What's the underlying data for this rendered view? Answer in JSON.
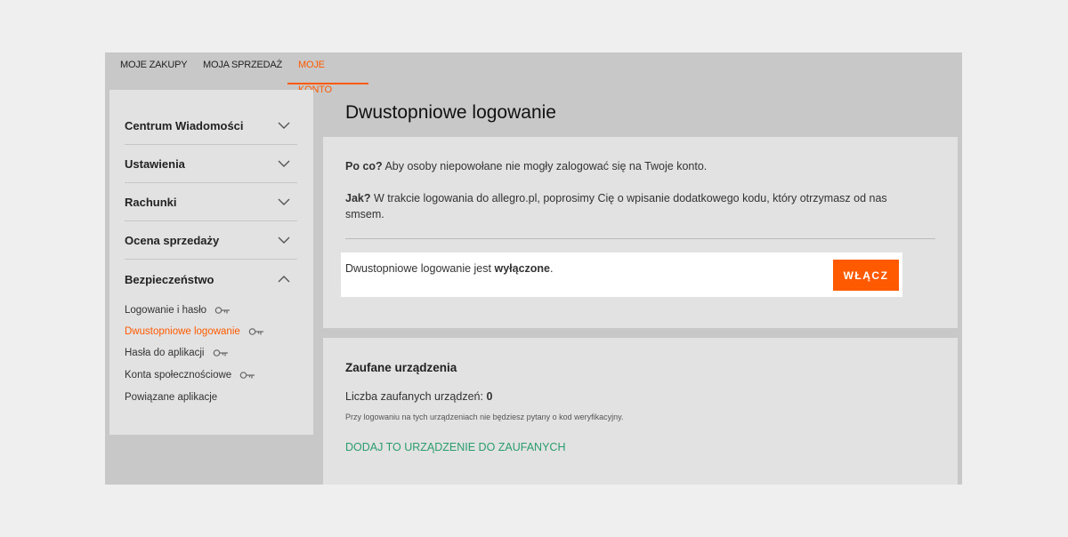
{
  "topnav": {
    "tabs": [
      {
        "label": "MOJE ZAKUPY"
      },
      {
        "label": "MOJA SPRZEDAŻ"
      },
      {
        "label": "MOJE KONTO"
      }
    ]
  },
  "sidebar": {
    "sections": [
      {
        "label": "Centrum Wiadomości"
      },
      {
        "label": "Ustawienia"
      },
      {
        "label": "Rachunki"
      },
      {
        "label": "Ocena sprzedaży"
      },
      {
        "label": "Bezpieczeństwo"
      }
    ],
    "security_items": [
      {
        "label": "Logowanie i hasło"
      },
      {
        "label": "Dwustopniowe logowanie"
      },
      {
        "label": "Hasła do aplikacji"
      },
      {
        "label": "Konta społecznościowe"
      },
      {
        "label": "Powiązane aplikacje"
      }
    ]
  },
  "main": {
    "title": "Dwustopniowe logowanie",
    "why_label": "Po co?",
    "why_text": " Aby osoby niepowołane nie mogły zalogować się na Twoje konto.",
    "how_label": "Jak?",
    "how_text": " W trakcie logowania do allegro.pl, poprosimy Cię o wpisanie dodatkowego kodu, który otrzymasz od nas smsem.",
    "status_prefix": "Dwustopniowe logowanie jest ",
    "status_value": "wyłączone",
    "status_suffix": ".",
    "enable_button": "WŁĄCZ"
  },
  "trusted": {
    "heading": "Zaufane urządzenia",
    "count_label": "Liczba zaufanych urządzeń: ",
    "count_value": "0",
    "note": "Przy logowaniu na tych urządzeniach nie będziesz pytany o kod weryfikacyjny.",
    "add_link": "DODAJ TO URZĄDZENIE DO ZAUFANYCH"
  },
  "colors": {
    "accent": "#ff5a00",
    "link_green": "#2a9d6e"
  },
  "icons": {
    "chevron_down": "chevron-down-icon",
    "chevron_up": "chevron-up-icon",
    "key": "key-icon"
  }
}
